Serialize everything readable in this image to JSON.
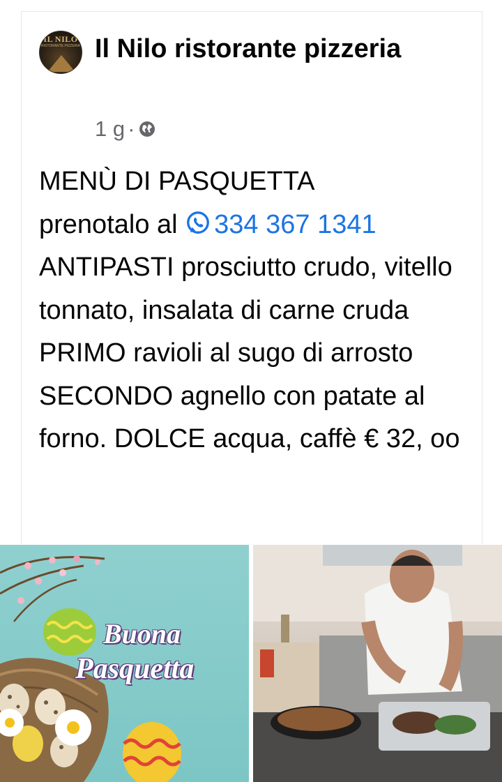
{
  "post": {
    "page_name": "Il Nilo ristorante pizzeria",
    "time": "1 g",
    "separator": "·",
    "privacy_icon": "globe-icon",
    "avatar_logo_text": "IL NILO",
    "avatar_logo_subtext": "RISTORANTE PIZZERIA",
    "text_line1": "MENÙ DI PASQUETTA",
    "text_prenota": "prenotalo al ",
    "phone": "334 367 1341",
    "text_body": "  ANTIPASTI prosciutto crudo, vitello tonnato, insalata di carne cruda PRIMO ravioli al sugo di arrosto SECONDO agnello con patate al forno. DOLCE acqua, caffè € 32, oo"
  },
  "images": {
    "left_greeting_1": "Buona",
    "left_greeting_2": "Pasquetta"
  },
  "colors": {
    "link": "#1b74e4",
    "meta": "#65676b",
    "text": "#050505"
  }
}
